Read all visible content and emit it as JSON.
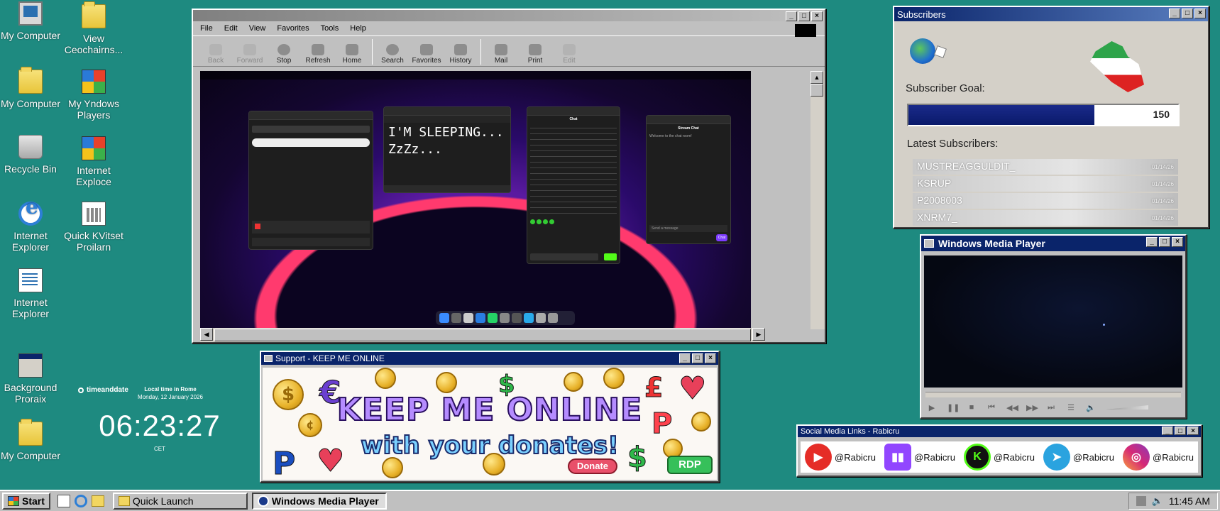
{
  "desktop_icons": [
    {
      "label": "My Computer",
      "icon": "computer-icon"
    },
    {
      "label": "View Ceochairns...",
      "icon": "folder-icon"
    },
    {
      "label": "My Computer",
      "icon": "computer-folder-icon"
    },
    {
      "label": "My Yndows Players",
      "icon": "windows-logo-icon"
    },
    {
      "label": "Recycle Bin",
      "icon": "recycle-bin-icon"
    },
    {
      "label": "Internet Exploce",
      "icon": "windows-logo-icon"
    },
    {
      "label": "Internet Explorer",
      "icon": "internet-explorer-icon"
    },
    {
      "label": "Quick KVitset Proilarn",
      "icon": "calculator-icon"
    },
    {
      "label": "Internet Explorer",
      "icon": "document-icon"
    },
    {
      "label": "Background Proraix",
      "icon": "window-info-icon"
    },
    {
      "label": "My Computer",
      "icon": "folder-icon"
    }
  ],
  "clock_widget": {
    "brand": "timeanddate",
    "location": "Local time in Rome",
    "date": "Monday, 12 January 2026",
    "time": "06:23:27",
    "timezone": "CET"
  },
  "browser": {
    "menu": [
      "File",
      "Edit",
      "View",
      "Favorites",
      "Tools",
      "Help"
    ],
    "toolbar": [
      {
        "label": "Back",
        "disabled": true
      },
      {
        "label": "Forward",
        "disabled": true
      },
      {
        "label": "Stop",
        "disabled": false
      },
      {
        "label": "Refresh",
        "disabled": false
      },
      {
        "label": "Home",
        "disabled": false
      },
      {
        "label": "Search",
        "disabled": false
      },
      {
        "label": "Favorites",
        "disabled": false
      },
      {
        "label": "History",
        "disabled": false
      },
      {
        "label": "Mail",
        "disabled": false
      },
      {
        "label": "Print",
        "disabled": false
      },
      {
        "label": "Edit",
        "disabled": true
      }
    ],
    "screen": {
      "notepad_text": "I'M SLEEPING...\nZzZz...",
      "chat_title": "Chat",
      "stream_chat_title": "Stream Chat",
      "stream_chat_welcome": "Welcome to the chat room!",
      "send_message": "Send a message",
      "chat_button": "Chat"
    }
  },
  "subscribers": {
    "title": "Subscribers",
    "goal_label": "Subscriber Goal:",
    "goal_value": "150",
    "progress": 0.69,
    "latest_label": "Latest Subscribers:",
    "latest": [
      {
        "name": "MUSTREAGGULDIT_",
        "meta": "01/14/26"
      },
      {
        "name": "KSRUP",
        "meta": "01/14/26"
      },
      {
        "name": "P2008003",
        "meta": "01/14/26"
      },
      {
        "name": "XNRM7_",
        "meta": "01/14/26"
      }
    ]
  },
  "media_player": {
    "title": "Windows Media Player"
  },
  "support": {
    "title": "Support - KEEP ME ONLINE",
    "headline": "KEEP ME ONLINE",
    "subline": "with your donates!",
    "donate": "Donate",
    "rdp": "RDP"
  },
  "social": {
    "title": "Social Media Links - Rabicru",
    "links": [
      {
        "platform": "youtube",
        "handle": "@Rabicru",
        "color": "#e52d27"
      },
      {
        "platform": "twitch",
        "handle": "@Rabicru",
        "color": "#9146ff"
      },
      {
        "platform": "kick",
        "handle": "@Rabicru",
        "color": "#53fc18"
      },
      {
        "platform": "telegram",
        "handle": "@Rabicru",
        "color": "#2aa3df"
      },
      {
        "platform": "instagram",
        "handle": "@Rabicru",
        "color": "#d62976"
      }
    ]
  },
  "taskbar": {
    "start": "Start",
    "tasks": [
      "Quick Launch",
      "Windows Media Player"
    ],
    "clock": "11:45 AM"
  }
}
